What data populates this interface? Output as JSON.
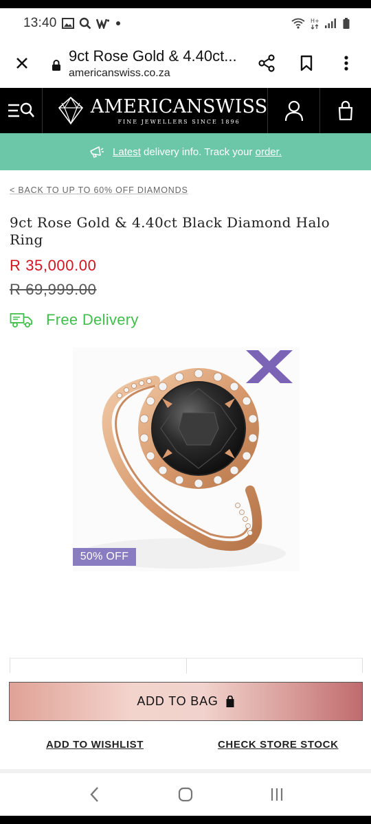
{
  "status_bar": {
    "time": "13:40",
    "icons": [
      "gallery-icon",
      "search-icon",
      "wordpress-icon",
      "dot-icon",
      "wifi-icon",
      "ht-signal-icon",
      "signal-icon",
      "battery-icon"
    ]
  },
  "browser": {
    "page_title": "9ct Rose Gold & 4.40ct...",
    "domain": "americanswiss.co.za"
  },
  "site_header": {
    "brand": "AMERICANSWISS",
    "tagline": "FINE JEWELLERS SINCE 1896"
  },
  "delivery_banner": {
    "link1": "Latest",
    "mid": " delivery info. Track your ",
    "link2": "order."
  },
  "product": {
    "back_link": "< BACK TO UP TO 60% OFF DIAMONDS",
    "title": "9ct Rose Gold & 4.40ct Black Diamond Halo Ring",
    "price": "R 35,000.00",
    "was_price": "R 69,999.00",
    "free_delivery": "Free Delivery",
    "discount_badge": "50% OFF"
  },
  "actions": {
    "add_to_bag": "ADD TO BAG",
    "wishlist": "ADD TO WISHLIST",
    "store_stock": "CHECK STORE STOCK"
  },
  "colors": {
    "delivery_banner": "#6cc7a8",
    "price_red": "#d2141e",
    "free_delivery_green": "#3fbf4a",
    "badge_purple": "#8a7cc0"
  }
}
